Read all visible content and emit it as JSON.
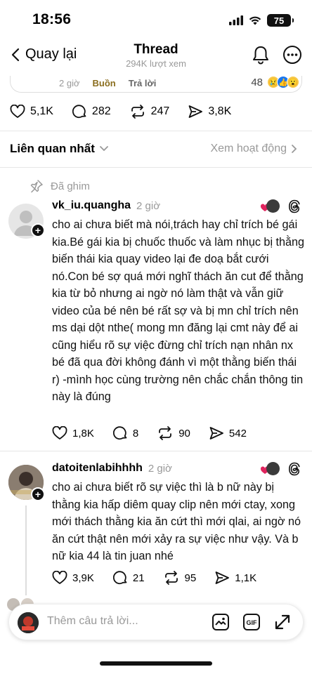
{
  "status": {
    "time": "18:56",
    "battery": "75"
  },
  "nav": {
    "back_label": "Quay lại",
    "title": "Thread",
    "subtitle": "294K lượt xem"
  },
  "parent_meta": {
    "time": "2 giờ",
    "tag": "Buồn",
    "reply": "Trả lời",
    "reaction_count": "48"
  },
  "post_actions": {
    "likes": "5,1K",
    "comments": "282",
    "reposts": "247",
    "shares": "3,8K"
  },
  "sort": {
    "label": "Liên quan nhất",
    "activity": "Xem hoạt động"
  },
  "pinned_label": "Đã ghim",
  "comments": [
    {
      "username": "vk_iu.quangha",
      "time": "2 giờ",
      "text": "cho ai chưa biết mà nói,trách hay chỉ trích bé gái kia.Bé gái kia bị chuốc thuốc và làm nhục bị thằng biến thái kia quay video lại đe doạ bắt cưới nó.Con bé sợ quá mới nghĩ thách ăn cut để thằng kia từ bỏ nhưng ai ngờ nó làm thật và vẫn giữ video của bé nên bé rất sợ và bị mn chỉ trích nên ms dại dột nthe( mong mn đăng lại cmt này để ai cũng hiểu rõ sự việc đừng chỉ trích nạn nhân nx bé đã qua đời không đánh vì một thằng biến thái r) -mình học cùng trường nên chắc chắn thông tin này là đúng",
      "likes": "1,8K",
      "replies": "8",
      "reposts": "90",
      "shares": "542"
    },
    {
      "username": "datoitenlabihhhh",
      "time": "2 giờ",
      "text": "cho ai chưa biết rõ sự việc thì là b nữ này bị thằng kia hấp diêm quay clip nên mới ctay, xong mới thách thằng kia ăn cứt thì mới qlai, ai ngờ nó ăn cứt thật nên mới xảy ra sự việc như vậy. Và b nữ kia 44 là tin juan nhé",
      "likes": "3,9K",
      "replies": "21",
      "reposts": "95",
      "shares": "1,1K"
    }
  ],
  "composer": {
    "placeholder": "Thêm câu trả lời..."
  },
  "colors": {
    "accent_red": "#e0245e",
    "muted": "#999999",
    "buon": "#8a6d1e"
  }
}
